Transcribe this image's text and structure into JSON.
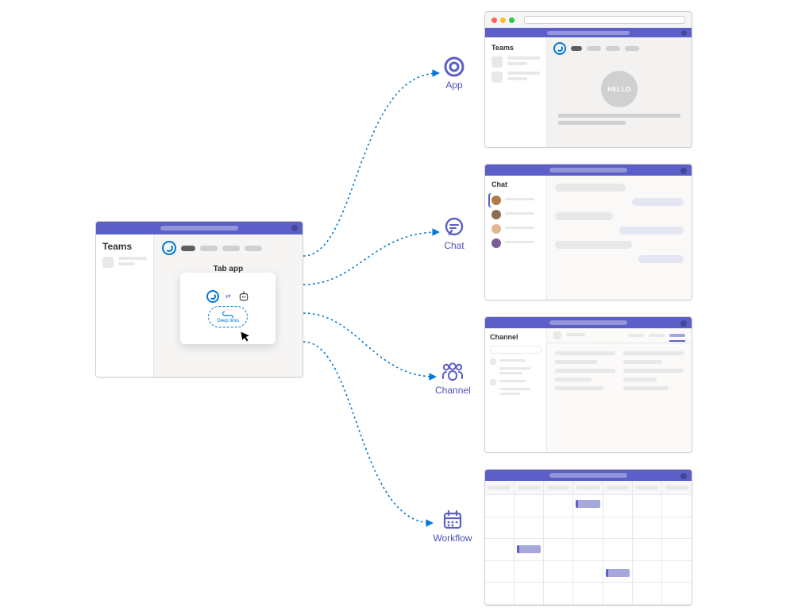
{
  "source": {
    "sidebar_label": "Teams",
    "tab_app_label": "Tab app",
    "deep_link_label": "Deep links"
  },
  "destinations": {
    "app": {
      "label": "App",
      "sidebar_label": "Teams",
      "hello_text": "HELLO"
    },
    "chat": {
      "label": "Chat",
      "sidebar_label": "Chat"
    },
    "channel": {
      "label": "Channel",
      "sidebar_label": "Channel"
    },
    "workflow": {
      "label": "Workflow"
    }
  },
  "colors": {
    "brand_purple": "#5b5fc7",
    "accent_blue": "#0078d4"
  }
}
